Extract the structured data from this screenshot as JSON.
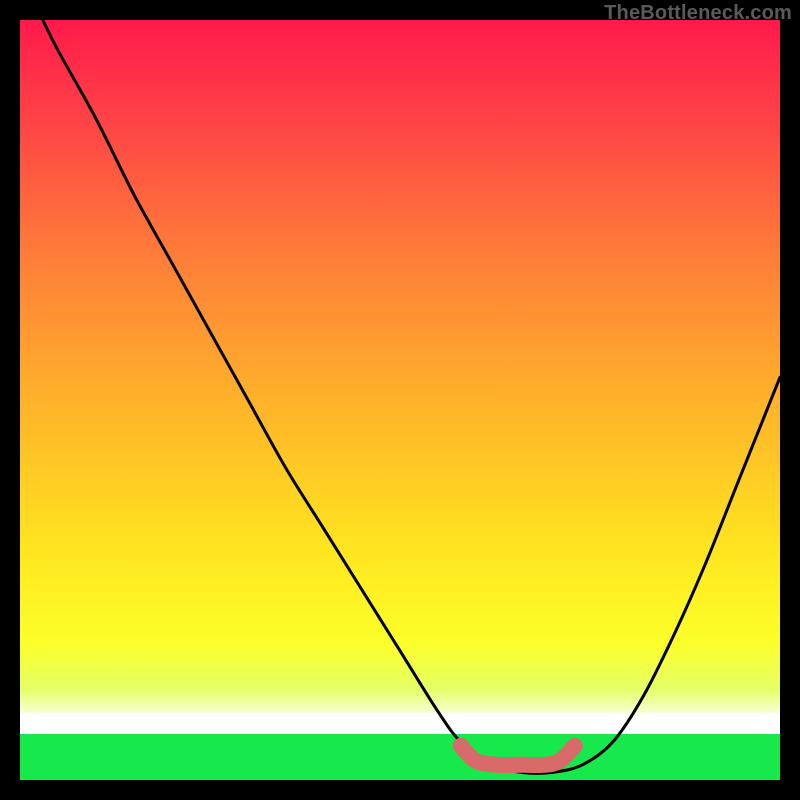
{
  "attribution": "TheBottleneck.com",
  "chart_data": {
    "type": "line",
    "title": "",
    "xlabel": "",
    "ylabel": "",
    "xlim": [
      0,
      100
    ],
    "ylim": [
      0,
      100
    ],
    "series": [
      {
        "name": "bottleneck-curve",
        "x": [
          3,
          5,
          10,
          15,
          20,
          25,
          30,
          35,
          40,
          45,
          50,
          55,
          58,
          62,
          66,
          70,
          74,
          78,
          82,
          86,
          90,
          94,
          98,
          100
        ],
        "y": [
          100,
          96,
          87,
          77,
          68,
          59,
          50,
          41,
          33,
          25,
          17,
          9,
          5,
          2,
          1,
          1,
          2,
          5,
          11,
          19,
          28,
          38,
          48,
          53
        ]
      },
      {
        "name": "optimal-range-marker",
        "x": [
          58,
          60,
          63,
          66,
          69,
          71,
          73
        ],
        "y": [
          4.5,
          2.5,
          2,
          2,
          2,
          2.5,
          4.5
        ]
      }
    ],
    "gradient_stops": [
      {
        "pct": 0,
        "color": "#ff1a4b"
      },
      {
        "pct": 12,
        "color": "#ff3f47"
      },
      {
        "pct": 30,
        "color": "#ff7a3a"
      },
      {
        "pct": 50,
        "color": "#ffb22a"
      },
      {
        "pct": 70,
        "color": "#ffe61f"
      },
      {
        "pct": 82,
        "color": "#fcff2a"
      },
      {
        "pct": 88,
        "color": "#e6ff66"
      },
      {
        "pct": 92.5,
        "color": "#ffffff"
      },
      {
        "pct": 97,
        "color": "#17e84c"
      }
    ],
    "curve_color": "#000000",
    "marker_color": "#d96a6a",
    "white_strip": {
      "top_pct": 91.2,
      "height_pct": 2.8
    },
    "green_strip": {
      "top_pct": 94.0,
      "height_pct": 6.0,
      "color": "#17e84c"
    }
  }
}
